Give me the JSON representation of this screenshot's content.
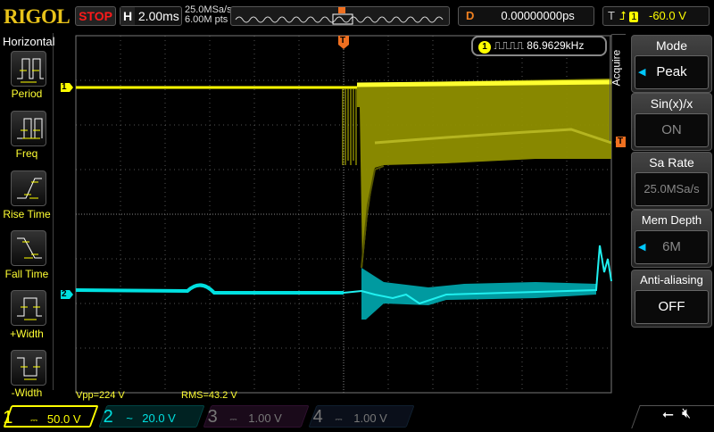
{
  "header": {
    "logo": "RIGOL",
    "run_state": "STOP",
    "h_key": "H",
    "timebase": "2.00ms",
    "sample_rate": "25.0MSa/s",
    "mem_points": "6.00M pts",
    "delay_key": "D",
    "delay": "0.00000000ps",
    "trig_key": "T",
    "trig_source": "1",
    "trig_level": "-60.0 V"
  },
  "left_menu": {
    "title": "Horizontal",
    "items": [
      {
        "label": "Period"
      },
      {
        "label": "Freq"
      },
      {
        "label": "Rise Time"
      },
      {
        "label": "Fall Time"
      },
      {
        "label": "+Width"
      },
      {
        "label": "-Width"
      }
    ]
  },
  "right_menu": {
    "title": "Acquire",
    "items": [
      {
        "label": "Mode",
        "value": "Peak"
      },
      {
        "label": "Sin(x)/x",
        "value": "ON"
      },
      {
        "label": "Sa Rate",
        "value": "25.0MSa/s"
      },
      {
        "label": "Mem Depth",
        "value": "6M"
      },
      {
        "label": "Anti-aliasing",
        "value": "OFF"
      }
    ]
  },
  "freq_counter": {
    "channel": "1",
    "value": "86.9629kHz"
  },
  "measurements": {
    "vpp": "Vpp=224  V",
    "rms": "RMS=43.2  V"
  },
  "markers": {
    "ch1": "1",
    "ch2": "2",
    "trigger": "T"
  },
  "channels": [
    {
      "num": "1",
      "coupling": "⎓",
      "scale": "50.0 V",
      "color": "#ffff00"
    },
    {
      "num": "2",
      "coupling": "~",
      "scale": "20.0 V",
      "color": "#00e5e5"
    },
    {
      "num": "3",
      "coupling": "⎓",
      "scale": "1.00 V",
      "color": "#c000c0"
    },
    {
      "num": "4",
      "coupling": "⎓",
      "scale": "1.00 V",
      "color": "#2060ff"
    }
  ]
}
